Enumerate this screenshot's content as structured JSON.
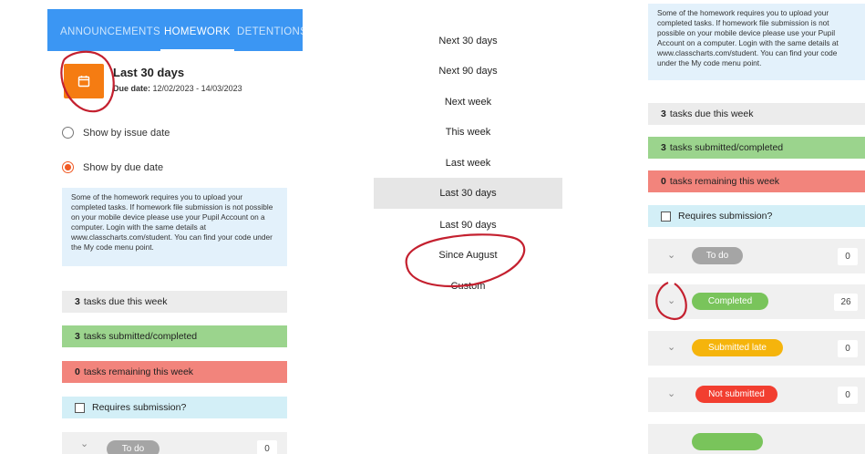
{
  "panel1": {
    "tabs": [
      {
        "label": "ANNOUNCEMENTS",
        "active": false
      },
      {
        "label": "HOMEWORK",
        "active": true
      },
      {
        "label": "DETENTIONS",
        "active": false
      }
    ],
    "range_title": "Last 30 days",
    "due_label": "Due date:",
    "due_value": "12/02/2023 - 14/03/2023",
    "radio_issue": "Show by issue date",
    "radio_due": "Show by due date",
    "info": "Some of the homework requires you to upload your completed tasks. If homework file submission is not possible on your mobile device please use your Pupil Account on a computer. Login with the same details at www.classcharts.com/student. You can find your code under the My code menu point.",
    "due_count": "3",
    "due_text": "tasks due this week",
    "submitted_count": "3",
    "submitted_text": "tasks submitted/completed",
    "remaining_count": "0",
    "remaining_text": "tasks remaining this week",
    "requires_submission": "Requires submission?",
    "todo_label": "To do",
    "todo_count": "0"
  },
  "panel2": {
    "items": [
      "Next 30 days",
      "Next 90 days",
      "Next week",
      "This week",
      "Last week",
      "Last 30 days",
      "Last 90 days",
      "Since August",
      "Custom"
    ],
    "selected": "Last 30 days"
  },
  "panel3": {
    "info": "Some of the homework requires you to upload your completed tasks. If homework file submission is not possible on your mobile device please use your Pupil Account on a computer. Login with the same details at www.classcharts.com/student. You can find your code under the My code menu point.",
    "due_count": "3",
    "due_text": "tasks due this week",
    "submitted_count": "3",
    "submitted_text": "tasks submitted/completed",
    "remaining_count": "0",
    "remaining_text": "tasks remaining this week",
    "requires_submission": "Requires submission?",
    "groups": [
      {
        "label": "To do",
        "count": "0",
        "color": "#a5a5a5"
      },
      {
        "label": "Completed",
        "count": "26",
        "color": "#79c45b"
      },
      {
        "label": "Submitted late",
        "count": "0",
        "color": "#f5b40c"
      },
      {
        "label": "Not submitted",
        "count": "0",
        "color": "#f23e30"
      }
    ]
  },
  "colors": {
    "tabbar": "#3b96f3",
    "calendar_button": "#f57c12",
    "annotation": "#c4202f"
  },
  "icons": {
    "calendar": "calendar-icon",
    "chevron": "chevron-down-icon"
  }
}
